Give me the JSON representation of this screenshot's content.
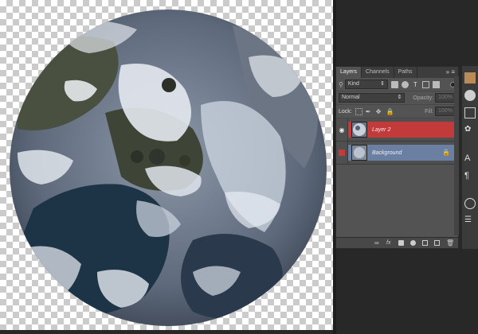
{
  "panel": {
    "tabs": [
      "Layers",
      "Channels",
      "Paths"
    ],
    "filter_kind": "Kind",
    "blend_mode": "Normal",
    "opacity_label": "Opacity:",
    "opacity_value": "100%",
    "lock_label": "Lock:",
    "fill_label": "Fill:",
    "fill_value": "100%"
  },
  "layers": [
    {
      "name": "Layer 2",
      "selected": true,
      "visible": true
    },
    {
      "name": "Background",
      "selected": false,
      "visible": false,
      "locked": true
    }
  ],
  "colors": {
    "selected_layer": "#c23a3a",
    "background_layer": "#6b7fa3",
    "panel_bg": "#535353",
    "canvas_bg": "#282828"
  },
  "icons": {
    "panel_footer": [
      "link-layers-icon",
      "fx-icon",
      "add-mask-icon",
      "adjustment-layer-icon",
      "new-group-icon",
      "new-layer-icon",
      "trash-icon"
    ],
    "right_toolbar": [
      "color-icon",
      "swatches-icon",
      "adjustments-icon",
      "styles-icon",
      "character-icon",
      "paragraph-icon",
      "layer-comps-icon",
      "properties-icon"
    ]
  }
}
